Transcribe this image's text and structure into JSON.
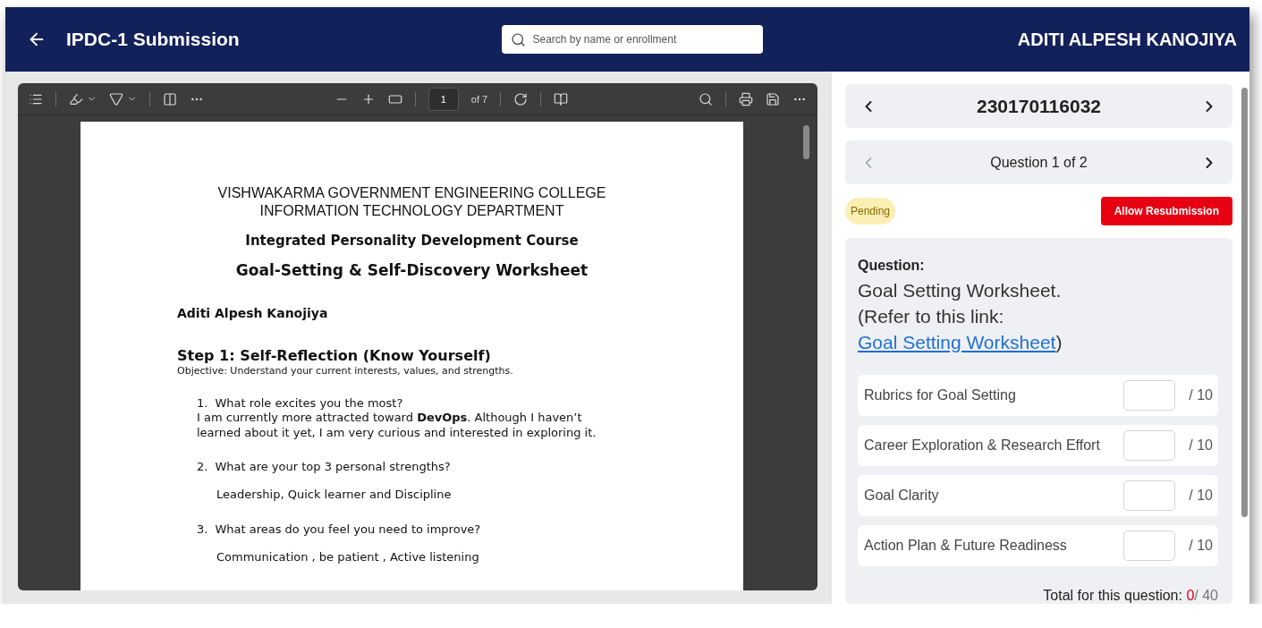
{
  "header": {
    "title": "IPDC-1 Submission",
    "search": {
      "placeholder": "Search by name or enrollment"
    },
    "user_name": "ADITI ALPESH KANOJIYA"
  },
  "pdf_viewer": {
    "page": "1",
    "page_count": "of 7",
    "lines": [
      {
        "kind": "center",
        "text": "VISHWAKARMA GOVERNMENT ENGINEERING COLLEGE"
      },
      {
        "kind": "center",
        "text": "INFORMATION TECHNOLOGY DEPARTMENT"
      },
      {
        "kind": "course",
        "text": "Integrated Personality Development Course"
      },
      {
        "kind": "title",
        "text": "Goal-Setting & Self-Discovery Worksheet"
      },
      {
        "kind": "name",
        "text": "Aditi Alpesh Kanojiya"
      },
      {
        "kind": "step",
        "text": "Step 1: Self-Reflection (Know Yourself)"
      },
      {
        "kind": "objective",
        "text": "Objective: Understand your current interests, values, and strengths."
      },
      {
        "kind": "question",
        "number": "1.",
        "text": "What role excites you the most?"
      },
      {
        "kind": "note",
        "text": "I am currently more attracted toward **DevOps**. Although I haven’t learned about it yet, I am very curious and interested in exploring it."
      },
      {
        "kind": "question",
        "number": "2.",
        "text": "What are your top 3 personal strengths?"
      },
      {
        "kind": "answer",
        "text": "Leadership, Quick learner and Discipline"
      },
      {
        "kind": "question",
        "number": "3.",
        "text": "What areas do you feel you need to improve?"
      },
      {
        "kind": "answer",
        "text": "Communication , be patient , Active listening"
      }
    ]
  },
  "review": {
    "enrollment": "230170116032",
    "enrollment_prev_disabled": false,
    "question_nav": "Question 1 of 2",
    "question_prev_disabled": true,
    "status": "Pending",
    "action_button": "Allow Resubmission",
    "question": {
      "label": "Question:",
      "text": "Goal Setting Worksheet.",
      "link_prefix": "(Refer to this link: ",
      "link": "Goal Setting Worksheet",
      "link_suffix": ")"
    },
    "rubrics": [
      {
        "name": "Rubrics for Goal Setting",
        "max": "/ 10"
      },
      {
        "name": "Career Exploration & Research Effort",
        "max": "/ 10"
      },
      {
        "name": "Goal Clarity",
        "max": "/ 10"
      },
      {
        "name": "Action Plan & Future Readiness",
        "max": "/ 10"
      }
    ],
    "total": {
      "label": "Total for this question:",
      "score": "0",
      "max": "/ 40"
    }
  }
}
